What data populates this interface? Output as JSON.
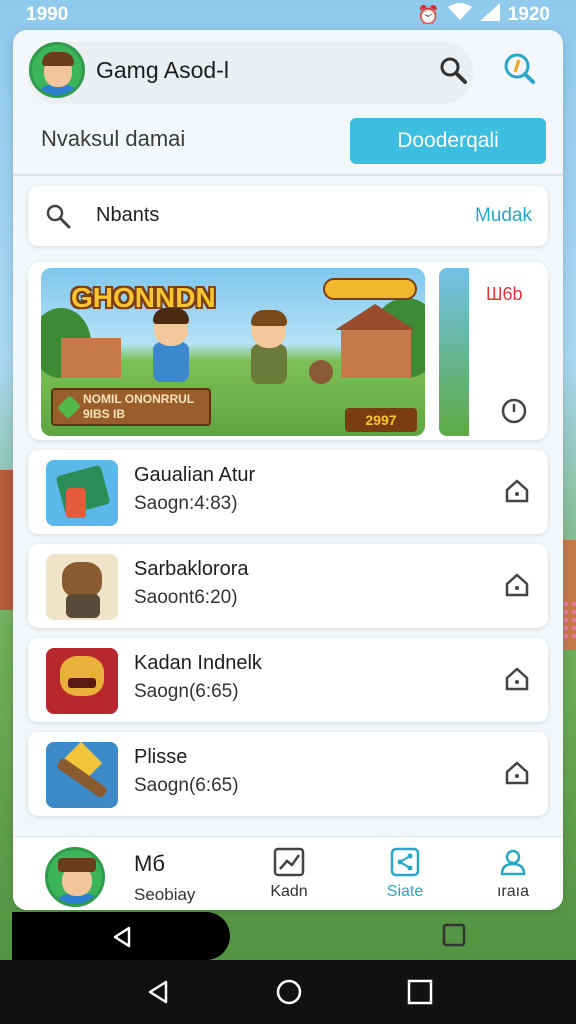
{
  "status_bar": {
    "time_left": "1990",
    "time_right": "1920"
  },
  "header": {
    "app_title": "Gamg Asod-l",
    "subtitle": "Nvaksul damai",
    "primary_button": "Dooderqali"
  },
  "search": {
    "query": "Nbants",
    "action": "Mudak"
  },
  "banner": {
    "logo_text": "GHONNDN",
    "plaque_line1": "NOMIL ONONRRUL",
    "plaque_line2": "9IBS     IB",
    "score": "2997",
    "side_label": "Ш6b"
  },
  "games": [
    {
      "title": "Gaualian Atur",
      "meta": "Saogn:4:83)"
    },
    {
      "title": "Sarbaklorora",
      "meta": "Saoont6:20)"
    },
    {
      "title": "Kadan Indnelk",
      "meta": "Saogn(6:65)"
    },
    {
      "title": "Plisse",
      "meta": "Saogn(6:65)"
    }
  ],
  "bottom_nav": {
    "me_title": "Мб",
    "me_sub": "Seobiay",
    "items": [
      {
        "label": "Kadn",
        "icon": "chart-icon",
        "active": false
      },
      {
        "label": "Siate",
        "icon": "share-icon",
        "active": true
      },
      {
        "label": "ıraıa",
        "icon": "person-icon",
        "active": false
      }
    ]
  },
  "colors": {
    "accent": "#3bbee0",
    "accent_text": "#27a7c8",
    "card_bg": "#f3f7fa"
  }
}
